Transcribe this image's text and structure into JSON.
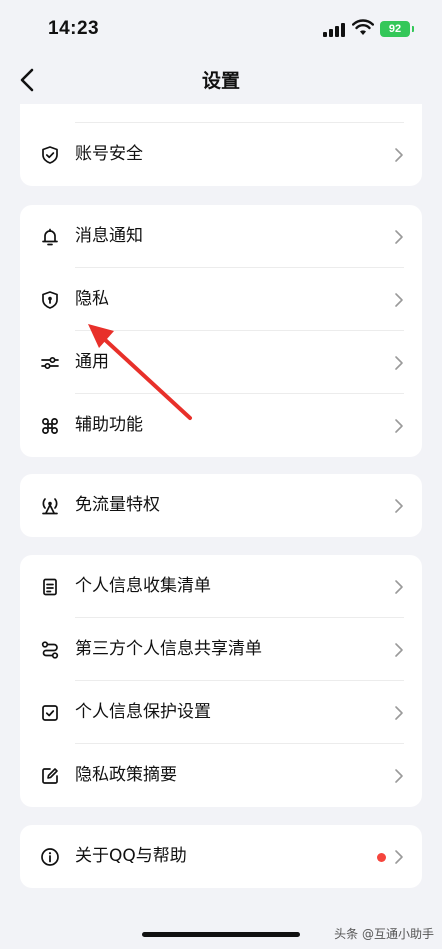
{
  "status_bar": {
    "time": "14:23",
    "battery": "92"
  },
  "nav": {
    "title": "设置"
  },
  "groups": [
    {
      "items": [
        {
          "label": "账号安全",
          "icon": "shield-check-icon"
        }
      ]
    },
    {
      "items": [
        {
          "label": "消息通知",
          "icon": "bell-icon"
        },
        {
          "label": "隐私",
          "icon": "privacy-shield-icon"
        },
        {
          "label": "通用",
          "icon": "sliders-icon"
        },
        {
          "label": "辅助功能",
          "icon": "command-icon"
        }
      ]
    },
    {
      "items": [
        {
          "label": "免流量特权",
          "icon": "antenna-icon"
        }
      ]
    },
    {
      "items": [
        {
          "label": "个人信息收集清单",
          "icon": "document-icon"
        },
        {
          "label": "第三方个人信息共享清单",
          "icon": "share-route-icon"
        },
        {
          "label": "个人信息保护设置",
          "icon": "checkbox-icon"
        },
        {
          "label": "隐私政策摘要",
          "icon": "edit-icon"
        }
      ]
    },
    {
      "items": [
        {
          "label": "关于QQ与帮助",
          "icon": "info-icon",
          "badge": "red-dot"
        }
      ]
    }
  ],
  "annotation": {
    "type": "red-arrow",
    "target": "隐私",
    "color": "#e8302a"
  },
  "watermark": "头条 @互通小助手",
  "colors": {
    "background": "#f2f3f7",
    "card": "#ffffff",
    "battery": "#34c759",
    "badge": "#f5453d"
  }
}
